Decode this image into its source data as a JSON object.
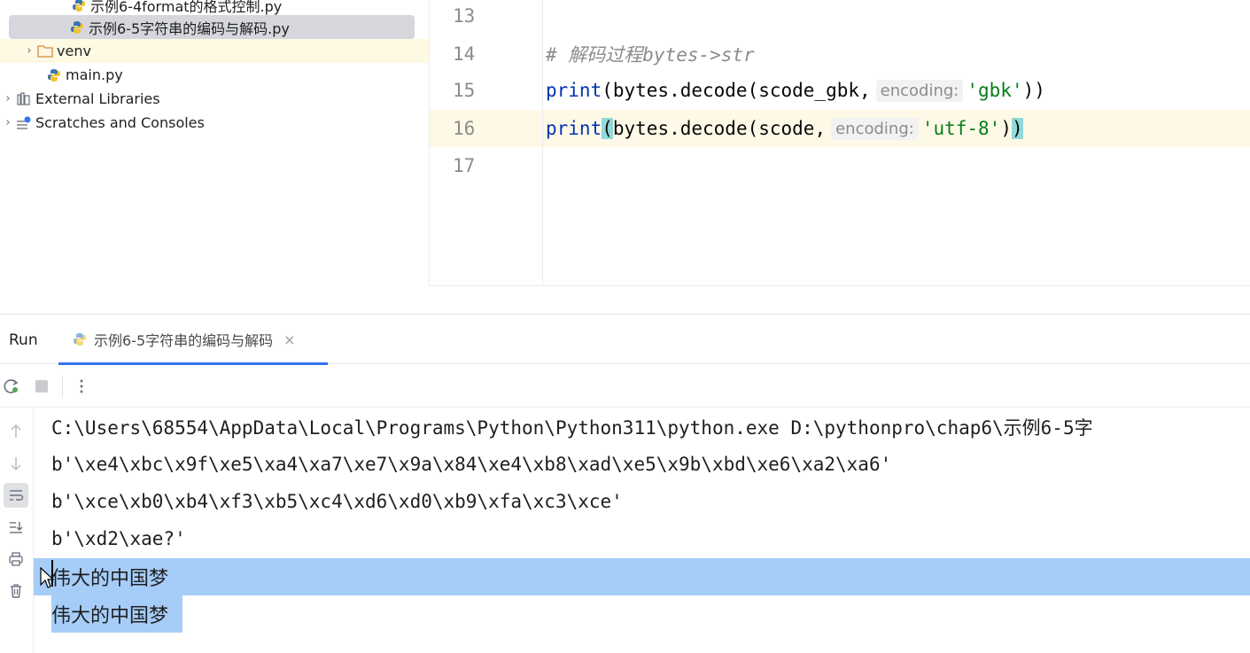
{
  "project_tree": {
    "items": [
      {
        "label": "示例6-4format的格式控制.py",
        "type": "python-file"
      },
      {
        "label": "示例6-5字符串的编码与解码.py",
        "type": "python-file",
        "selected": true
      },
      {
        "label": "venv",
        "type": "folder",
        "collapsed": true
      },
      {
        "label": "main.py",
        "type": "python-file"
      },
      {
        "label": "External Libraries",
        "type": "library",
        "collapsed": true
      },
      {
        "label": "Scratches and Consoles",
        "type": "scratches",
        "collapsed": true
      }
    ]
  },
  "editor": {
    "current_line": 16,
    "lines": [
      {
        "number": "13",
        "tokens": []
      },
      {
        "number": "14",
        "tokens": [
          {
            "cls": "comment",
            "text": "# 解码过程bytes->str"
          }
        ]
      },
      {
        "number": "15",
        "tokens": [
          {
            "cls": "kw-builtin",
            "text": "print"
          },
          {
            "cls": "plain",
            "text": "(bytes.decode(scode_gbk,"
          },
          {
            "cls": "hint",
            "text": "encoding:"
          },
          {
            "cls": "str",
            "text": "'gbk'"
          },
          {
            "cls": "plain",
            "text": "))"
          }
        ]
      },
      {
        "number": "16",
        "tokens": [
          {
            "cls": "kw-builtin",
            "text": "print"
          },
          {
            "cls": "plain brace-hl",
            "text": "("
          },
          {
            "cls": "plain",
            "text": "bytes.decode(scode,"
          },
          {
            "cls": "hint",
            "text": "encoding:"
          },
          {
            "cls": "str",
            "text": "'utf-8'"
          },
          {
            "cls": "plain",
            "text": ")"
          },
          {
            "cls": "plain brace-hl",
            "text": ")"
          }
        ]
      },
      {
        "number": "17",
        "tokens": []
      }
    ]
  },
  "run_panel": {
    "title": "Run",
    "tab_label": "示例6-5字符串的编码与解码",
    "tab_close": "×",
    "output": [
      {
        "text": "C:\\Users\\68554\\AppData\\Local\\Programs\\Python\\Python311\\python.exe D:\\pythonpro\\chap6\\示例6-5字",
        "selection": "none"
      },
      {
        "text": "b'\\xe4\\xbc\\x9f\\xe5\\xa4\\xa7\\xe7\\x9a\\x84\\xe4\\xb8\\xad\\xe5\\x9b\\xbd\\xe6\\xa2\\xa6'",
        "selection": "none"
      },
      {
        "text": "b'\\xce\\xb0\\xb4\\xf3\\xb5\\xc4\\xd6\\xd0\\xb9\\xfa\\xc3\\xce'",
        "selection": "none"
      },
      {
        "text": "b'\\xd2\\xae?'",
        "selection": "none"
      },
      {
        "text": "伟大的中国梦",
        "selection": "full"
      },
      {
        "text": "伟大的中国梦",
        "selection": "partial"
      }
    ]
  },
  "colors": {
    "selection": "#a6cdf8",
    "current_line": "#fef9e6",
    "tab_accent": "#3574f0",
    "brace_highlight": "#93d9d9"
  }
}
